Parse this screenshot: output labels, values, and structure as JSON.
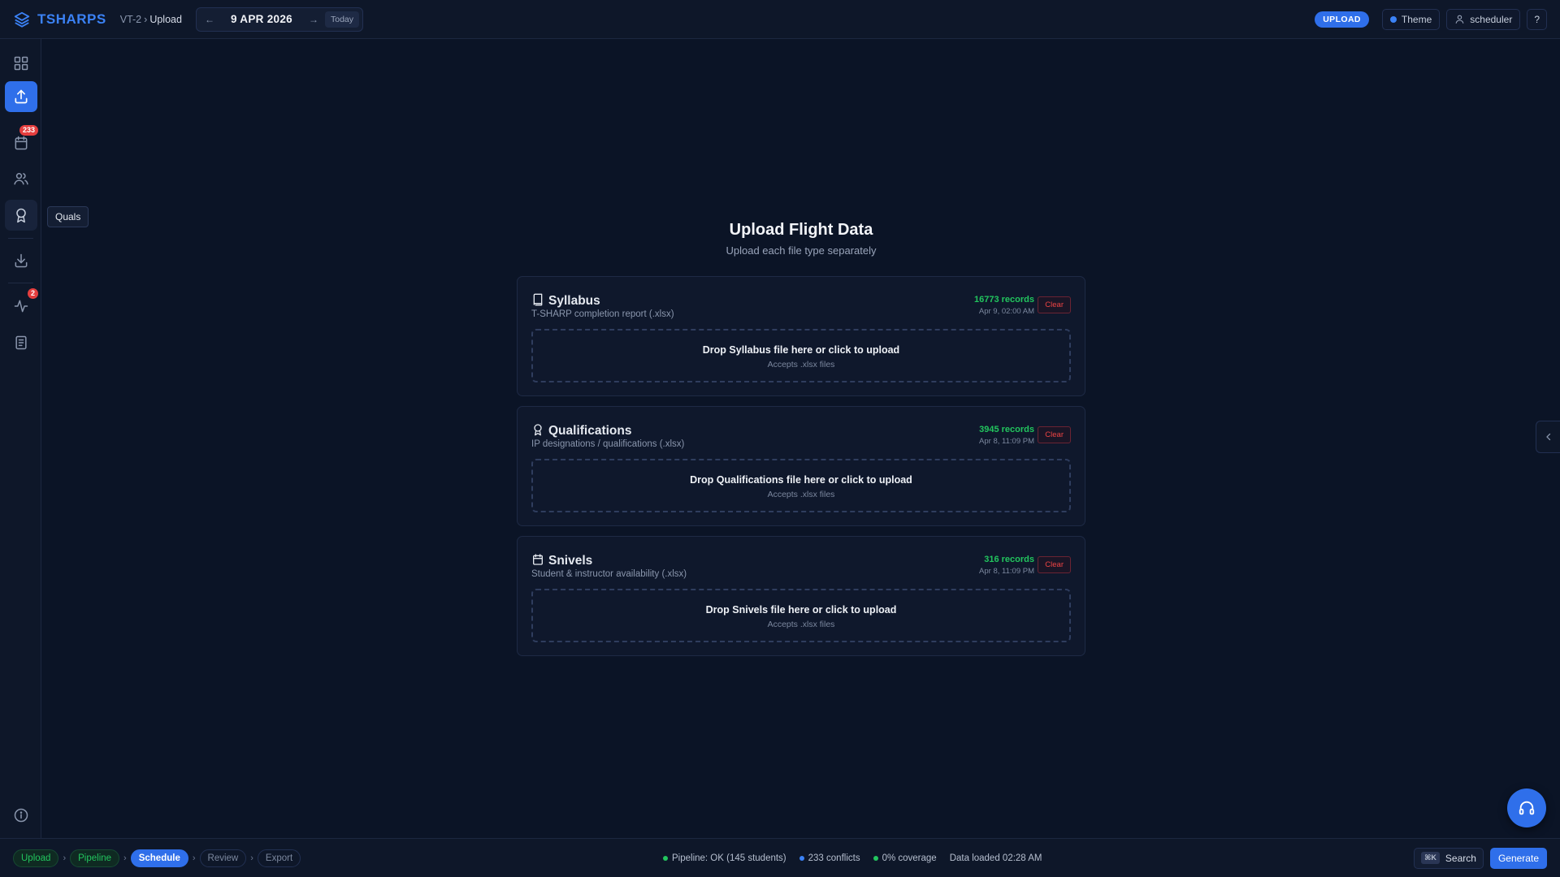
{
  "app": {
    "name": "TSHARPS",
    "logo_icon": "layers-icon"
  },
  "breadcrumb": {
    "parent": "VT-2",
    "separator": "›",
    "current": "Upload"
  },
  "date_nav": {
    "prev": "←",
    "date": "9 APR 2026",
    "next": "→",
    "today": "Today"
  },
  "header": {
    "mode_badge": "UPLOAD",
    "theme_label": "Theme",
    "user_label": "scheduler",
    "help_label": "?"
  },
  "sidebar": {
    "items": [
      {
        "name": "dashboard",
        "icon": "grid-icon"
      },
      {
        "name": "upload",
        "icon": "upload-icon",
        "active": true
      },
      {
        "name": "schedule",
        "icon": "calendar-icon",
        "badge": "233"
      },
      {
        "name": "people",
        "icon": "users-icon"
      },
      {
        "name": "quals",
        "icon": "award-icon",
        "tooltip": "Quals"
      },
      {
        "name": "export",
        "icon": "download-icon"
      },
      {
        "name": "activity",
        "icon": "activity-icon",
        "badge": "2"
      },
      {
        "name": "log",
        "icon": "document-icon"
      },
      {
        "name": "info",
        "icon": "info-icon"
      }
    ]
  },
  "main": {
    "title": "Upload Flight Data",
    "subtitle": "Upload each file type separately",
    "cards": [
      {
        "title": "Syllabus",
        "icon": "book-icon",
        "description": "T-SHARP completion report (.xlsx)",
        "records": "16773 records",
        "timestamp": "Apr 9, 02:00 AM",
        "clear": "Clear",
        "drop_text": "Drop Syllabus file here or click to upload",
        "accepts": "Accepts .xlsx files"
      },
      {
        "title": "Qualifications",
        "icon": "award-icon",
        "description": "IP designations / qualifications (.xlsx)",
        "records": "3945 records",
        "timestamp": "Apr 8, 11:09 PM",
        "clear": "Clear",
        "drop_text": "Drop Qualifications file here or click to upload",
        "accepts": "Accepts .xlsx files"
      },
      {
        "title": "Snivels",
        "icon": "calendar-icon",
        "description": "Student & instructor availability (.xlsx)",
        "records": "316 records",
        "timestamp": "Apr 8, 11:09 PM",
        "clear": "Clear",
        "drop_text": "Drop Snivels file here or click to upload",
        "accepts": "Accepts .xlsx files"
      }
    ]
  },
  "workflow": {
    "steps": [
      {
        "label": "Upload",
        "state": "done"
      },
      {
        "label": "Pipeline",
        "state": "done"
      },
      {
        "label": "Schedule",
        "state": "current"
      },
      {
        "label": "Review",
        "state": "pending"
      },
      {
        "label": "Export",
        "state": "pending"
      }
    ],
    "separator": "›"
  },
  "status": {
    "pipeline": "Pipeline: OK (145 students)",
    "conflicts": "233 conflicts",
    "coverage": "0% coverage",
    "loaded": "Data loaded 02:28 AM"
  },
  "footer": {
    "search_shortcut": "⌘K",
    "search_label": "Search",
    "generate_label": "Generate"
  },
  "colors": {
    "accent": "#2f6fea",
    "success": "#22c55e",
    "danger": "#ef4444",
    "background": "#0b1426"
  }
}
